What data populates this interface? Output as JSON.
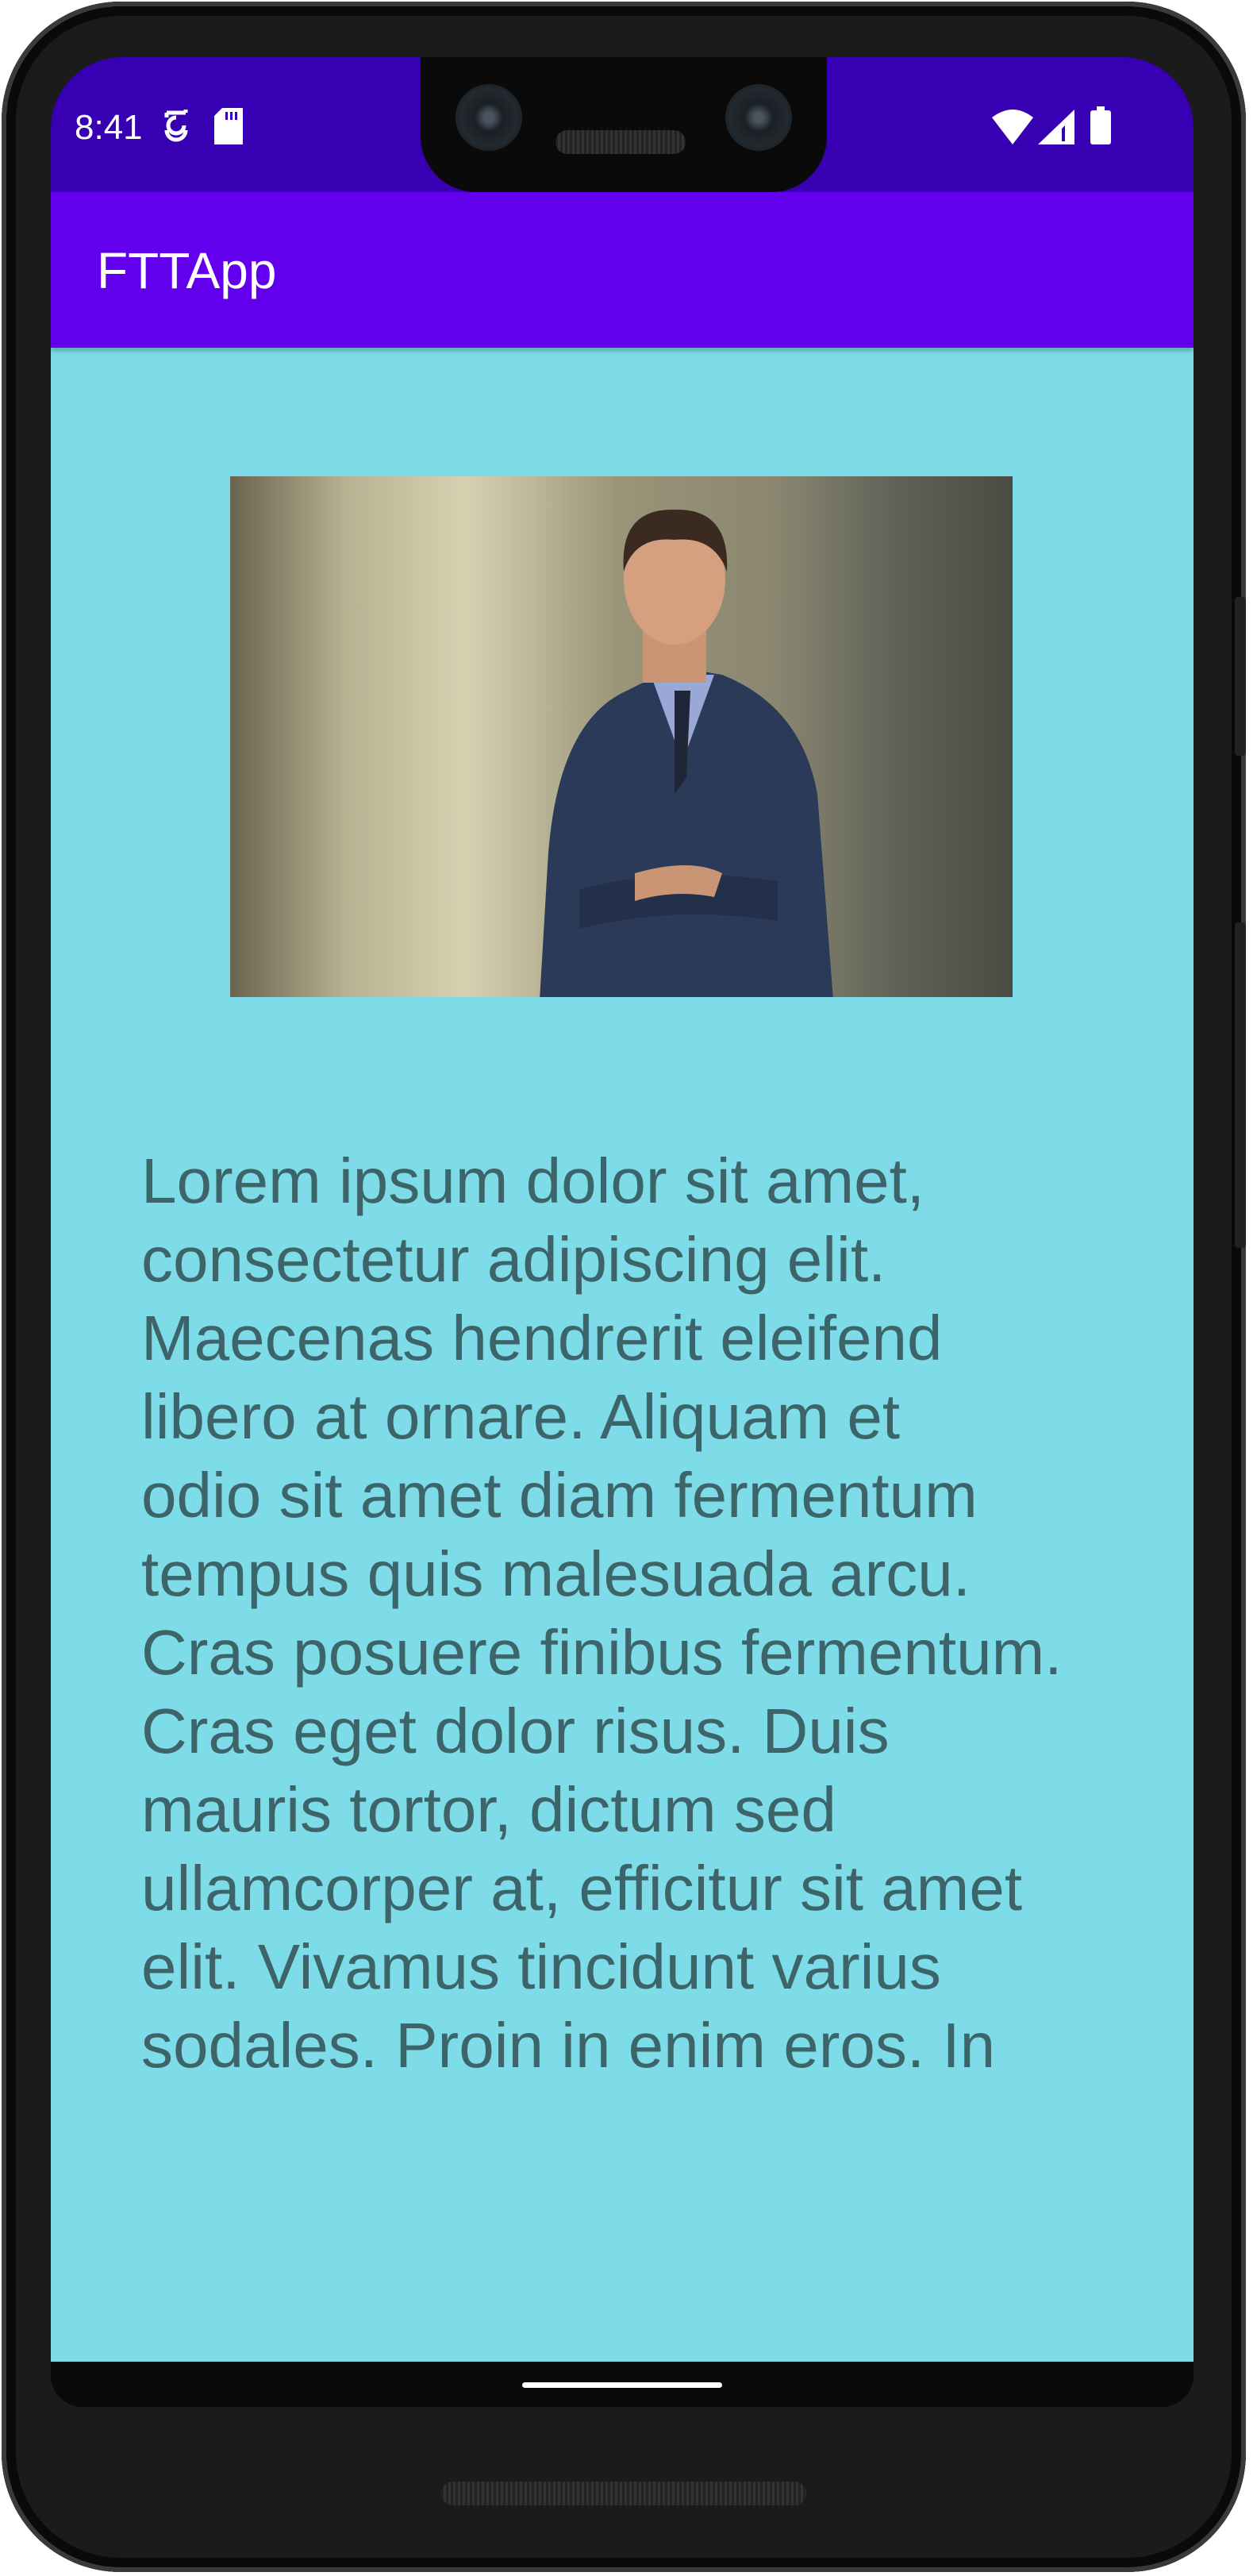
{
  "status_bar": {
    "time": "8:41",
    "left_icons": [
      "sync-icon",
      "sd-card-icon"
    ],
    "right_icons": [
      "wifi-icon",
      "signal-icon",
      "battery-icon"
    ]
  },
  "app_bar": {
    "title": "FTTApp"
  },
  "content": {
    "image": "businessman-photo",
    "paragraph_lines": [
      "Lorem ipsum dolor sit amet,",
      "consectetur adipiscing elit.",
      "Maecenas hendrerit eleifend",
      "libero at ornare. Aliquam et",
      "odio sit amet diam fermentum",
      "tempus quis malesuada arcu.",
      "Cras posuere finibus fermentum.",
      "Cras eget dolor risus. Duis",
      "mauris tortor, dictum sed",
      "ullamcorper at, efficitur sit amet",
      "elit. Vivamus tincidunt varius",
      "sodales. Proin in enim eros. In"
    ]
  },
  "colors": {
    "status_bar": "#3700b3",
    "app_bar": "#6200ee",
    "background": "#7ddce8",
    "text": "#3d6469"
  }
}
